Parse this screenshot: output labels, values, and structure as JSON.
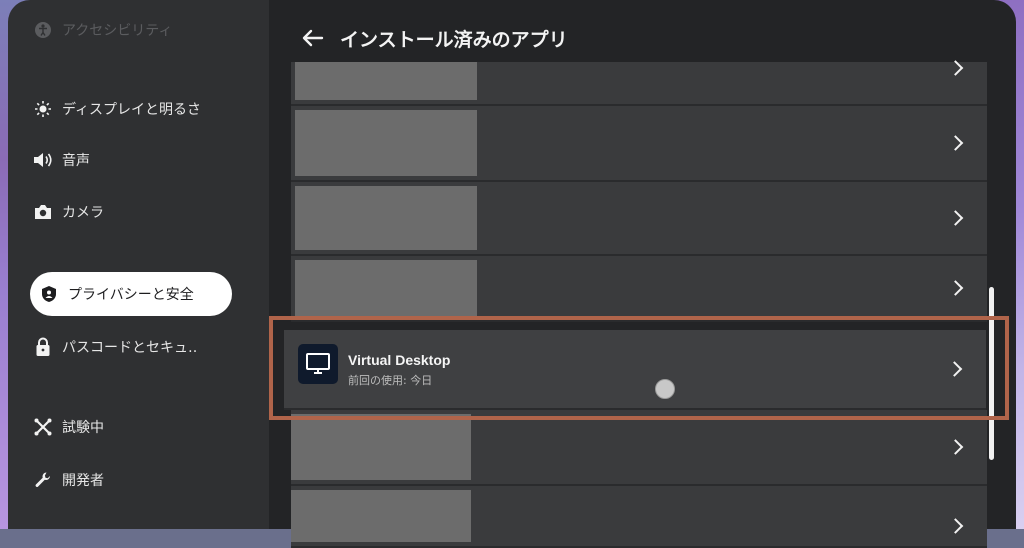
{
  "sidebar": {
    "items": [
      {
        "label": "アクセシビリティ",
        "icon": "accessibility-icon"
      },
      {
        "label": "ディスプレイと明るさ",
        "icon": "brightness-icon"
      },
      {
        "label": "音声",
        "icon": "speaker-icon"
      },
      {
        "label": "カメラ",
        "icon": "camera-icon"
      },
      {
        "label": "プライバシーと安全",
        "icon": "shield-icon"
      },
      {
        "label": "パスコードとセキュ‥",
        "icon": "lock-icon"
      },
      {
        "label": "試験中",
        "icon": "experiment-icon"
      },
      {
        "label": "開発者",
        "icon": "wrench-icon"
      }
    ]
  },
  "header": {
    "title": "インストール済みのアプリ"
  },
  "apps": {
    "virtual_desktop": {
      "name": "Virtual Desktop",
      "last_used": "前回の使用: 今日",
      "icon": "monitor-icon"
    }
  },
  "colors": {
    "highlight": "#b0644a",
    "sidebar_bg": "#2f3032",
    "main_bg": "#232426"
  }
}
